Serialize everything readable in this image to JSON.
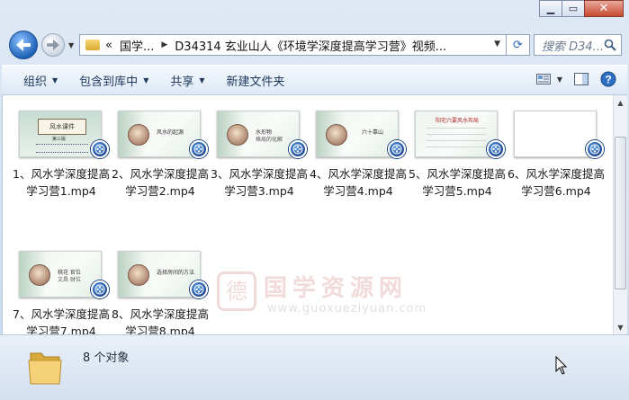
{
  "window": {
    "caption_buttons": [
      "minimize",
      "maximize",
      "close"
    ]
  },
  "nav": {
    "breadcrumb": [
      "«",
      "国学...",
      "D34314 玄业山人《环境学深度提高学习营》视频..."
    ],
    "search_placeholder": "搜索 D34..."
  },
  "toolbar": {
    "organize": "组织",
    "include_in_library": "包含到库中",
    "share": "共享",
    "new_folder": "新建文件夹"
  },
  "watermark": {
    "brand": "国学资源网",
    "url": "www.guoxueziyuan.com"
  },
  "files": [
    {
      "name": "1、风水学深度提高学习营1.mp4",
      "thumb": "first",
      "title": "风水课件",
      "subtitle": "第三版"
    },
    {
      "name": "2、风水学深度提高学习营2.mp4",
      "thumb": "slide",
      "caption": "风水的起源"
    },
    {
      "name": "3、风水学深度提高学习营3.mp4",
      "thumb": "slide",
      "caption": "水形物",
      "caption2": "格局的化解"
    },
    {
      "name": "4、风水学深度提高学习营4.mp4",
      "thumb": "slide",
      "caption": "六十靠山"
    },
    {
      "name": "5、风水学深度提高学习营5.mp4",
      "thumb": "list",
      "caption": "阳宅六要风水布局"
    },
    {
      "name": "6、风水学深度提高学习营6.mp4",
      "thumb": "blank"
    },
    {
      "name": "7、风水学深度提高学习营7.mp4",
      "thumb": "slide",
      "caption": "桃花 官位",
      "caption2": "文昌 财位"
    },
    {
      "name": "8、风水学深度提高学习营8.mp4",
      "thumb": "slide",
      "caption": "选择房间的方法"
    }
  ],
  "status": {
    "item_count": "8 个对象"
  }
}
